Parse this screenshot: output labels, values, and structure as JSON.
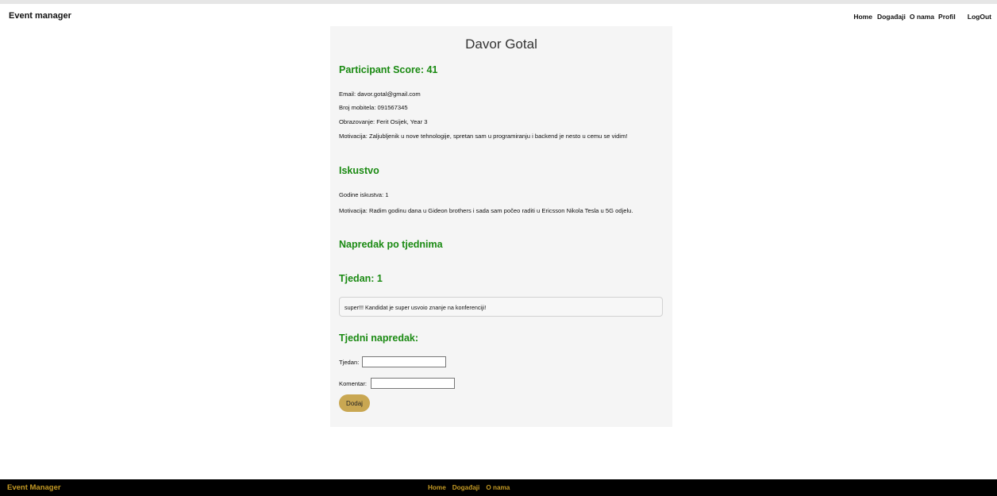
{
  "header": {
    "brand": "Event manager",
    "nav": [
      "Home",
      "Događaji",
      "O nama",
      "Profil",
      "LogOut"
    ]
  },
  "profile": {
    "name": "Davor Gotal",
    "score_heading": "Participant Score: 41",
    "email": "Email: davor.gotal@gmail.com",
    "phone": "Broj mobitela: 091567345",
    "education": "Obrazovanje: Ferit Osijek, Year 3",
    "motivation": "Motivacija: Zaljubljenik u nove tehnologije, spretan sam u programiranju i backend je nesto u cemu se vidim!"
  },
  "experience": {
    "heading": "Iskustvo",
    "years": "Godine iskustva: 1",
    "motivation": "Motivacija: Radim godinu dana u Gideon brothers i sada sam počeo raditi u Ericsson Nikola Tesla u 5G odjelu."
  },
  "progress": {
    "heading": "Napredak po tjednima",
    "week_heading": "Tjedan: 1",
    "week_comment": "super!!! Kandidat je super usvoio znanje na konferenciji!"
  },
  "form": {
    "heading": "Tjedni napredak:",
    "week_label": "Tjedan:",
    "week_value": "",
    "comment_label": "Komentar:",
    "comment_value": "",
    "submit_label": "Dodaj"
  },
  "footer": {
    "brand": "Event Manager",
    "nav": [
      "Home",
      "Događaji",
      "O nama"
    ]
  },
  "colors": {
    "heading_green": "#1a8a12",
    "button_gold": "#c9a752",
    "footer_gold": "#c59a24",
    "footer_bg": "#000000"
  }
}
